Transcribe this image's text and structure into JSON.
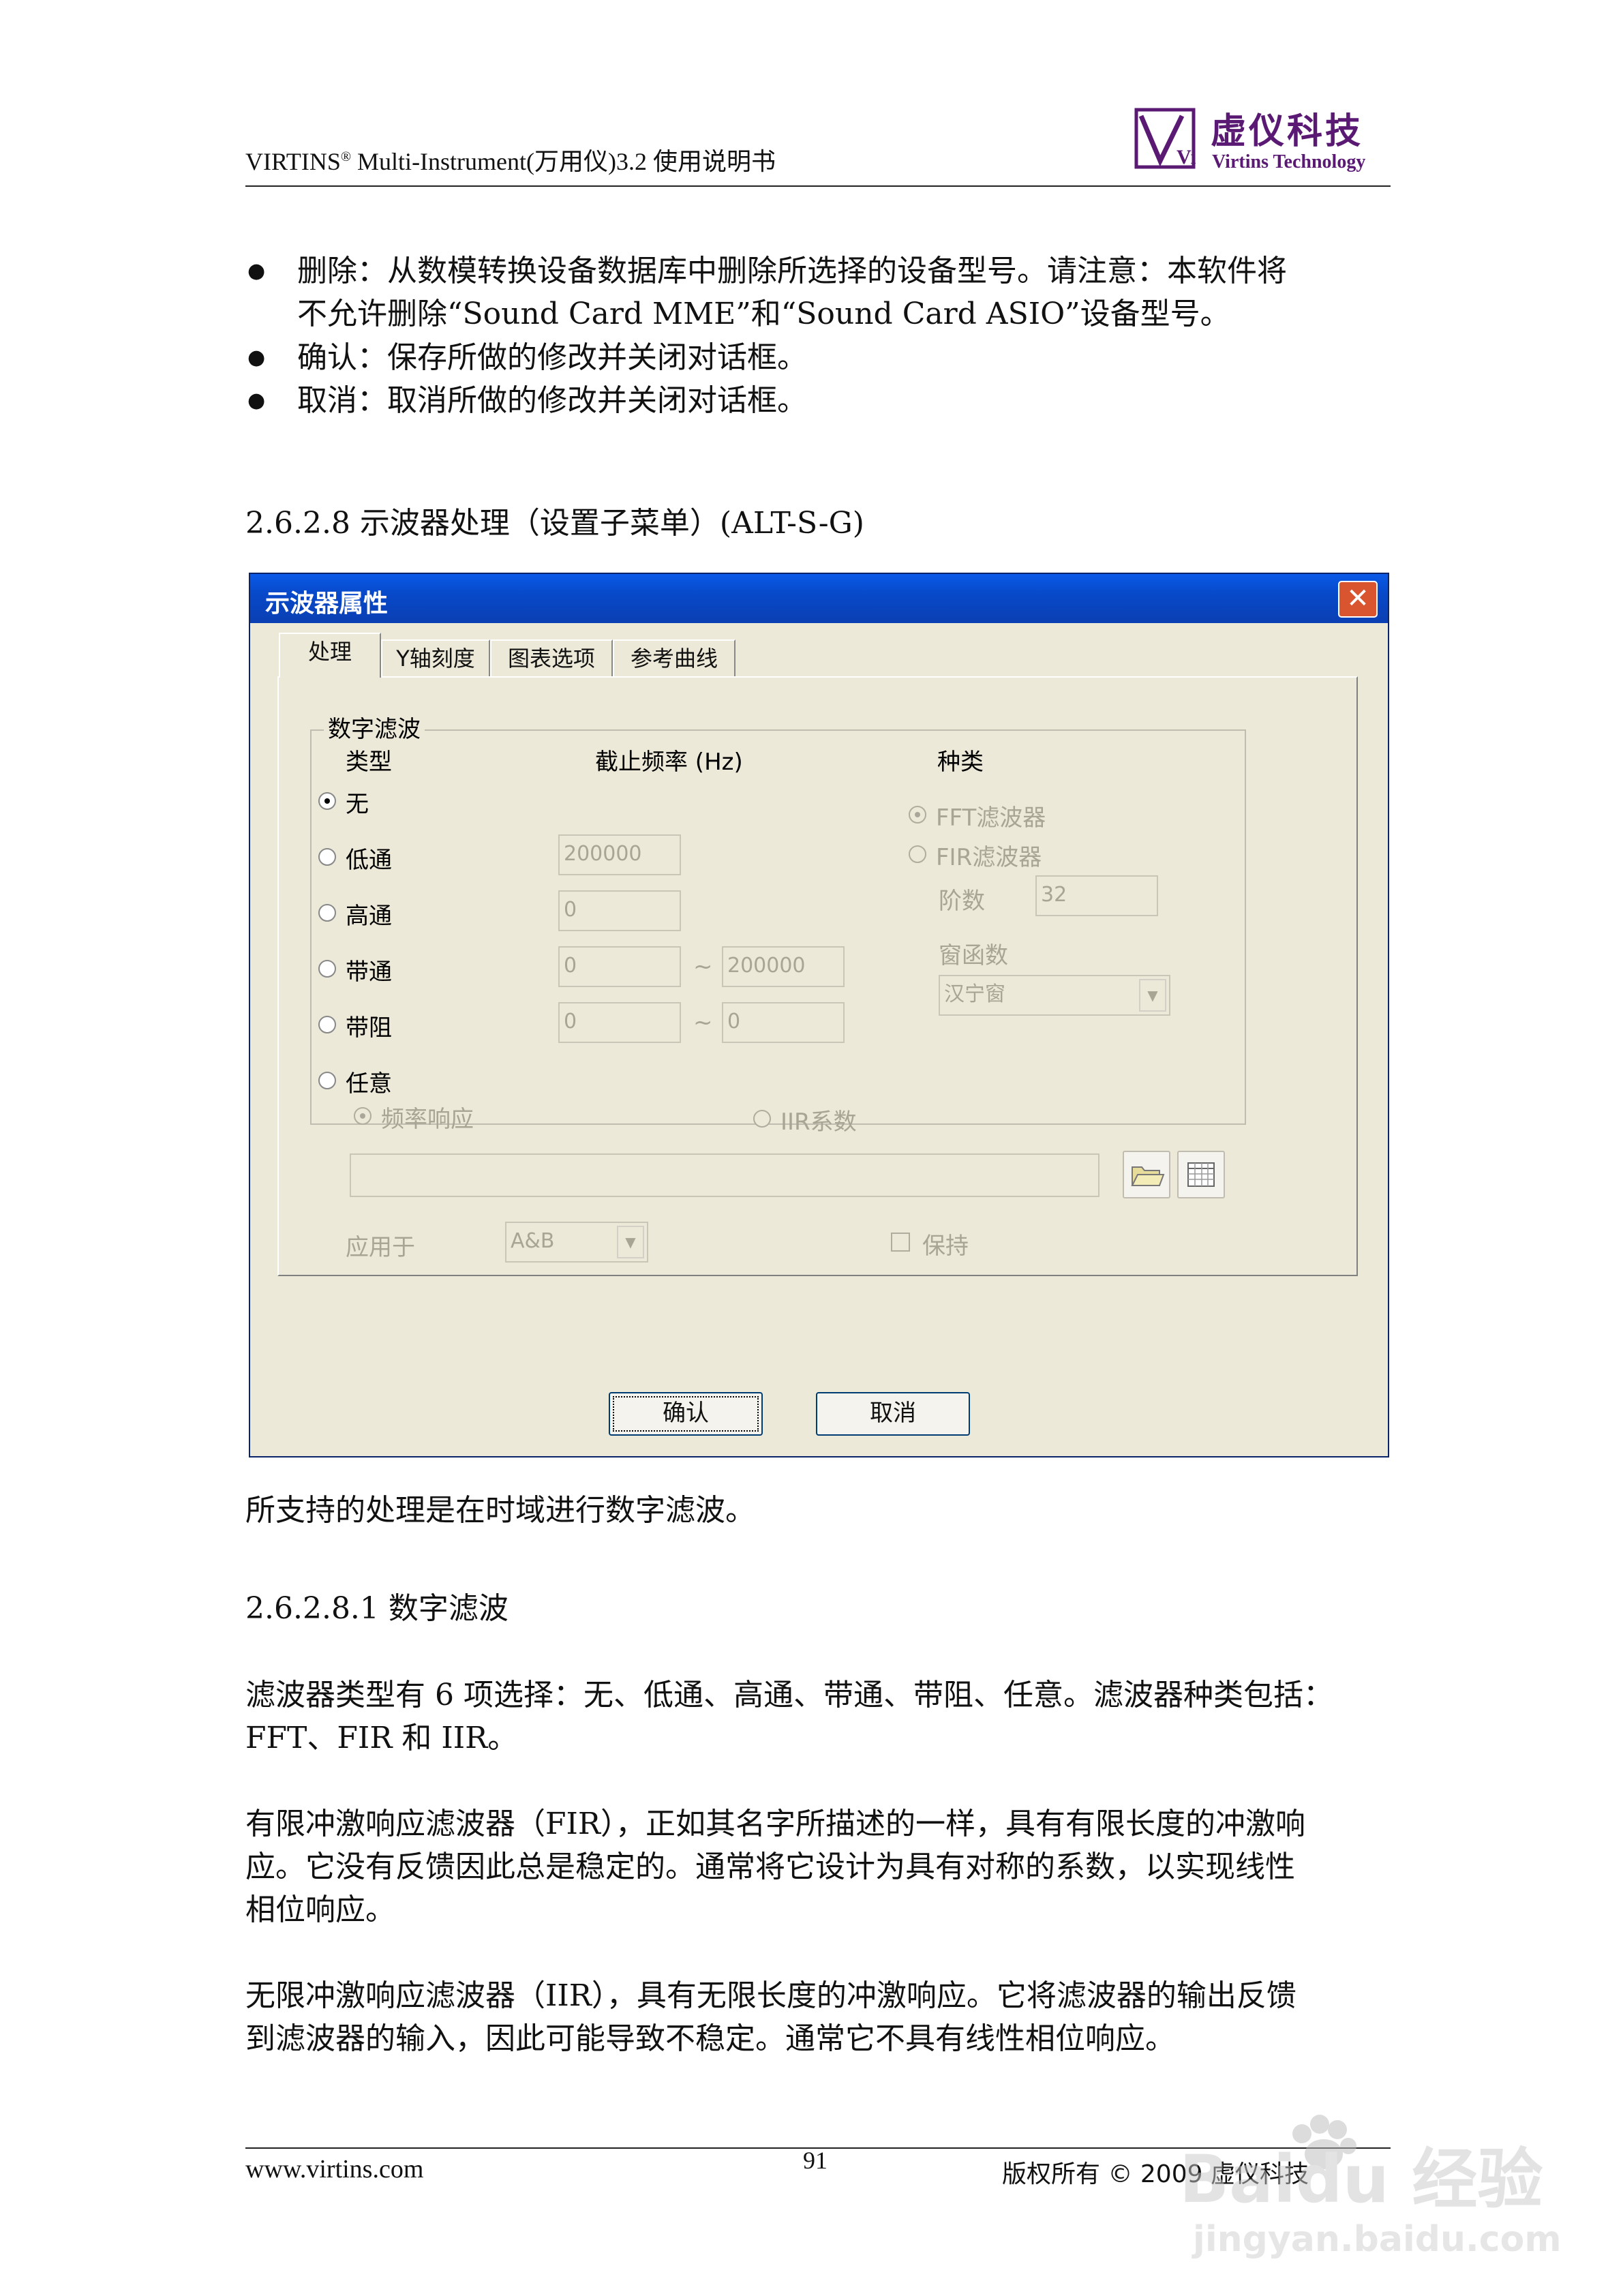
{
  "header": {
    "doc_title_pre": "VIRTINS",
    "doc_title_sup": "®",
    "doc_title_post": " Multi-Instrument(万用仪)3.2 使用说明书",
    "logo_cn": "虚仪科技",
    "logo_en": "Virtins Technology",
    "logo_mark": "Vi"
  },
  "bullets": [
    {
      "line1": "删除：从数模转换设备数据库中删除所选择的设备型号。请注意：本软件将",
      "line2": "不允许删除“Sound Card MME”和“Sound Card ASIO”设备型号。"
    },
    {
      "line1": "确认：保存所做的修改并关闭对话框。"
    },
    {
      "line1": "取消：取消所做的修改并关闭对话框。"
    }
  ],
  "section_heading": "2.6.2.8 示波器处理（设置子菜单）(ALT-S-G)",
  "dialog": {
    "title": "示波器属性",
    "close": "✕",
    "tabs": [
      "处理",
      "Y轴刻度",
      "图表选项",
      "参考曲线"
    ],
    "group_title": "数字滤波",
    "col_type": "类型",
    "col_cutoff": "截止频率 (Hz)",
    "col_kind": "种类",
    "filter_types": [
      "无",
      "低通",
      "高通",
      "带通",
      "带阻",
      "任意"
    ],
    "selected_type": "无",
    "lowpass_value": "200000",
    "highpass_value": "0",
    "bandpass_low": "0",
    "bandpass_high": "200000",
    "bandstop_low": "0",
    "bandstop_high": "0",
    "tilde": "~",
    "kind_fft": "FFT滤波器",
    "kind_fir": "FIR滤波器",
    "order_label": "阶数",
    "order_value": "32",
    "window_label": "窗函数",
    "window_value": "汉宁窗",
    "arb_freq_resp": "频率响应",
    "arb_iir": "IIR系数",
    "apply_label": "应用于",
    "apply_value": "A&B",
    "hold_label": "保持",
    "ok": "确认",
    "cancel": "取消"
  },
  "paragraphs": {
    "p1": "所支持的处理是在时域进行数字滤波。",
    "sub_heading": "2.6.2.8.1 数字滤波",
    "p2_l1": "滤波器类型有 6 项选择：无、低通、高通、带通、带阻、任意。滤波器种类包括：",
    "p2_l2": "FFT、FIR 和 IIR。",
    "p3_l1": "有限冲激响应滤波器（FIR），正如其名字所描述的一样，具有有限长度的冲激响",
    "p3_l2": "应。它没有反馈因此总是稳定的。通常将它设计为具有对称的系数，以实现线性",
    "p3_l3": "相位响应。",
    "p4_l1": "无限冲激响应滤波器（IIR），具有无限长度的冲激响应。它将滤波器的输出反馈",
    "p4_l2": "到滤波器的输入，因此可能导致不稳定。通常它不具有线性相位响应。"
  },
  "footer": {
    "url": "www.virtins.com",
    "page": "91",
    "copyright": "版权所有 © 2009 虚仪科技",
    "watermark_top": "Baidu 经验",
    "watermark_bottom": "jingyan.baidu.com"
  }
}
